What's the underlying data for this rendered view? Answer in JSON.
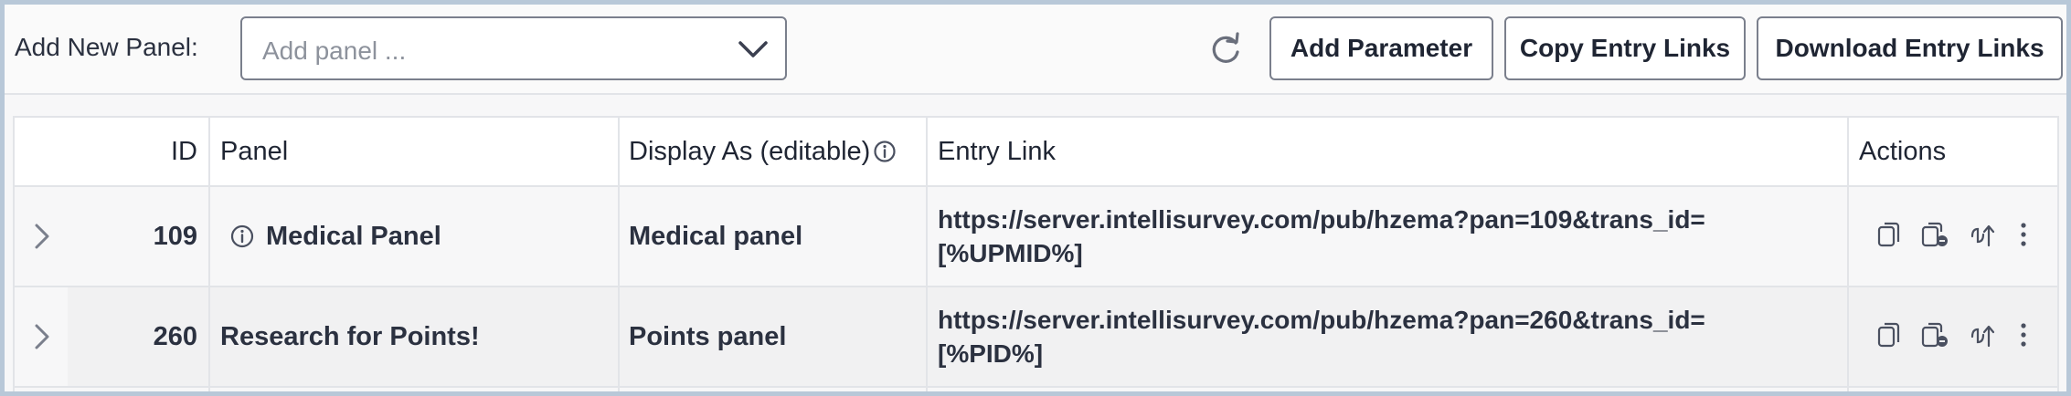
{
  "toolbar": {
    "add_new_panel_label": "Add New Panel:",
    "panel_select_placeholder": "Add panel ...",
    "add_parameter_label": "Add Parameter",
    "copy_entry_links_label": "Copy Entry Links",
    "download_entry_links_label": "Download Entry Links"
  },
  "table": {
    "columns": {
      "id": "ID",
      "panel": "Panel",
      "display_as": "Display As (editable)",
      "entry_link": "Entry Link",
      "actions": "Actions"
    },
    "rows": [
      {
        "id": "109",
        "panel": "Medical Panel",
        "display_as": "Medical panel",
        "entry_link_line1": "https://server.intellisurvey.com/pub/hzema?pan=109&trans_id=",
        "entry_link_line2": "[%UPMID%]"
      },
      {
        "id": "260",
        "panel": "Research for Points!",
        "display_as": "Points panel",
        "entry_link_line1": "https://server.intellisurvey.com/pub/hzema?pan=260&trans_id=",
        "entry_link_line2": "[%PID%]"
      }
    ]
  },
  "icons": {
    "dropdown": "chevron-down-icon",
    "refresh": "refresh-icon",
    "info": "info-circle-icon",
    "expand": "chevron-right-icon",
    "copy": "copy-icon",
    "copy_link": "copy-link-icon",
    "tracking": "tracking-icon",
    "more": "more-vertical-icon"
  }
}
